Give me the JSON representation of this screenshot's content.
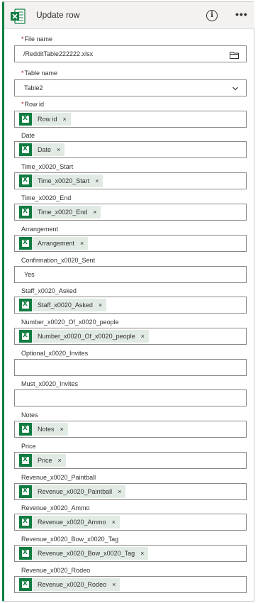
{
  "header": {
    "title": "Update row",
    "info_glyph": "i",
    "more_glyph": "•••"
  },
  "colors": {
    "excel_green": "#107c41",
    "token_bg": "#e1ebe3",
    "required": "#a4262c"
  },
  "fields": {
    "file_name": {
      "label": "File name",
      "required": "*",
      "value": "/RedditTable222222.xlsx",
      "icon": "folder-icon"
    },
    "table_name": {
      "label": "Table name",
      "required": "*",
      "value": "Table2",
      "icon": "chevron-down-icon"
    },
    "row_id": {
      "label": "Row id",
      "required": "*",
      "token": "Row id"
    },
    "date": {
      "label": "Date",
      "token": "Date"
    },
    "time_start": {
      "label": "Time_x0020_Start",
      "token": "Time_x0020_Start"
    },
    "time_end": {
      "label": "Time_x0020_End",
      "token": "Time_x0020_End"
    },
    "arrangement": {
      "label": "Arrangement",
      "token": "Arrangement"
    },
    "confirmation_sent": {
      "label": "Confirmation_x0020_Sent",
      "value": "Yes"
    },
    "staff_asked": {
      "label": "Staff_x0020_Asked",
      "token": "Staff_x0020_Asked"
    },
    "number_of_people": {
      "label": "Number_x0020_Of_x0020_people",
      "token": "Number_x0020_Of_x0020_people"
    },
    "optional_invites": {
      "label": "Optional_x0020_Invites",
      "value": ""
    },
    "must_invites": {
      "label": "Must_x0020_Invites",
      "value": ""
    },
    "notes": {
      "label": "Notes",
      "token": "Notes"
    },
    "price": {
      "label": "Price",
      "token": "Price"
    },
    "revenue_paintball": {
      "label": "Revenue_x0020_Paintball",
      "token": "Revenue_x0020_Paintball"
    },
    "revenue_ammo": {
      "label": "Revenue_x0020_Ammo",
      "token": "Revenue_x0020_Ammo"
    },
    "revenue_bow_tag": {
      "label": "Revenue_x0020_Bow_x0020_Tag",
      "token": "Revenue_x0020_Bow_x0020_Tag"
    },
    "revenue_rodeo": {
      "label": "Revenue_x0020_Rodeo",
      "token": "Revenue_x0020_Rodeo"
    }
  },
  "token_remove_glyph": "×"
}
